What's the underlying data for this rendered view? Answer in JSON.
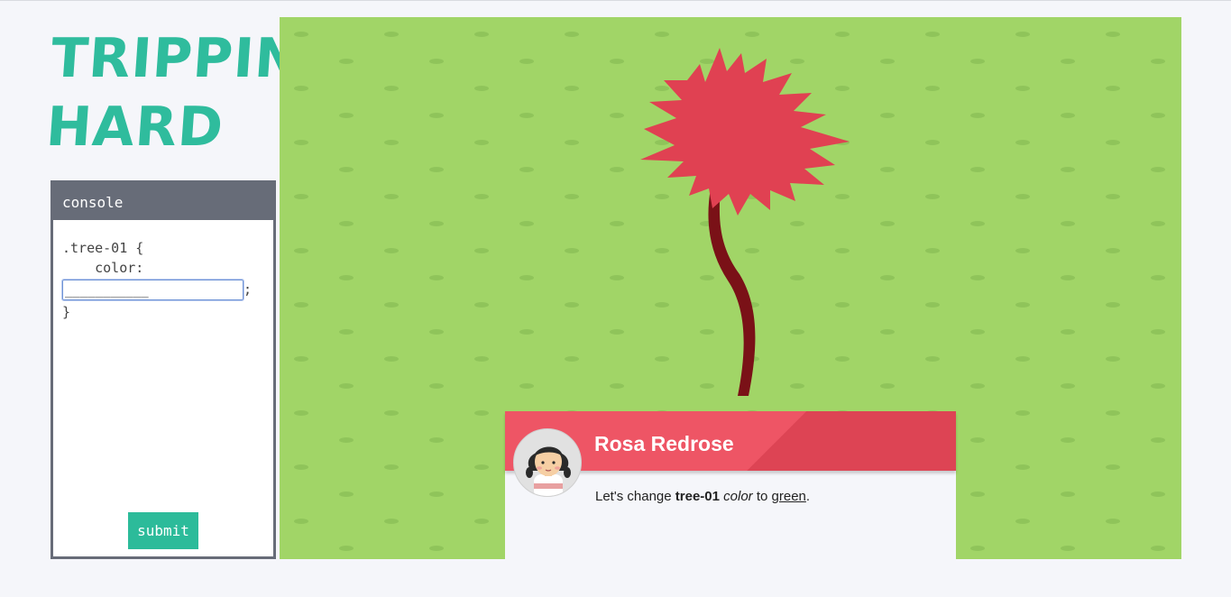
{
  "game": {
    "title_line1": "TRIPPIN'",
    "title_line2": "HARD"
  },
  "console": {
    "header": "console",
    "code_line1": ".tree-01 {",
    "code_line2": "    color:",
    "input_placeholder": "___________",
    "input_value": "",
    "semicolon": ";",
    "code_close": "}",
    "submit_label": "submit"
  },
  "scene": {
    "grass_color": "#a1d567",
    "tuft_color": "#8fc45a",
    "tree_trunk_color": "#7a1117",
    "tree_foliage_color": "#e04152"
  },
  "dialog": {
    "speaker": "Rosa Redrose",
    "text_before": "Let's change ",
    "selector": "tree-01",
    "property": "color",
    "text_middle": " to ",
    "value": "green",
    "text_end": ".",
    "header_color": "#ee5565"
  }
}
